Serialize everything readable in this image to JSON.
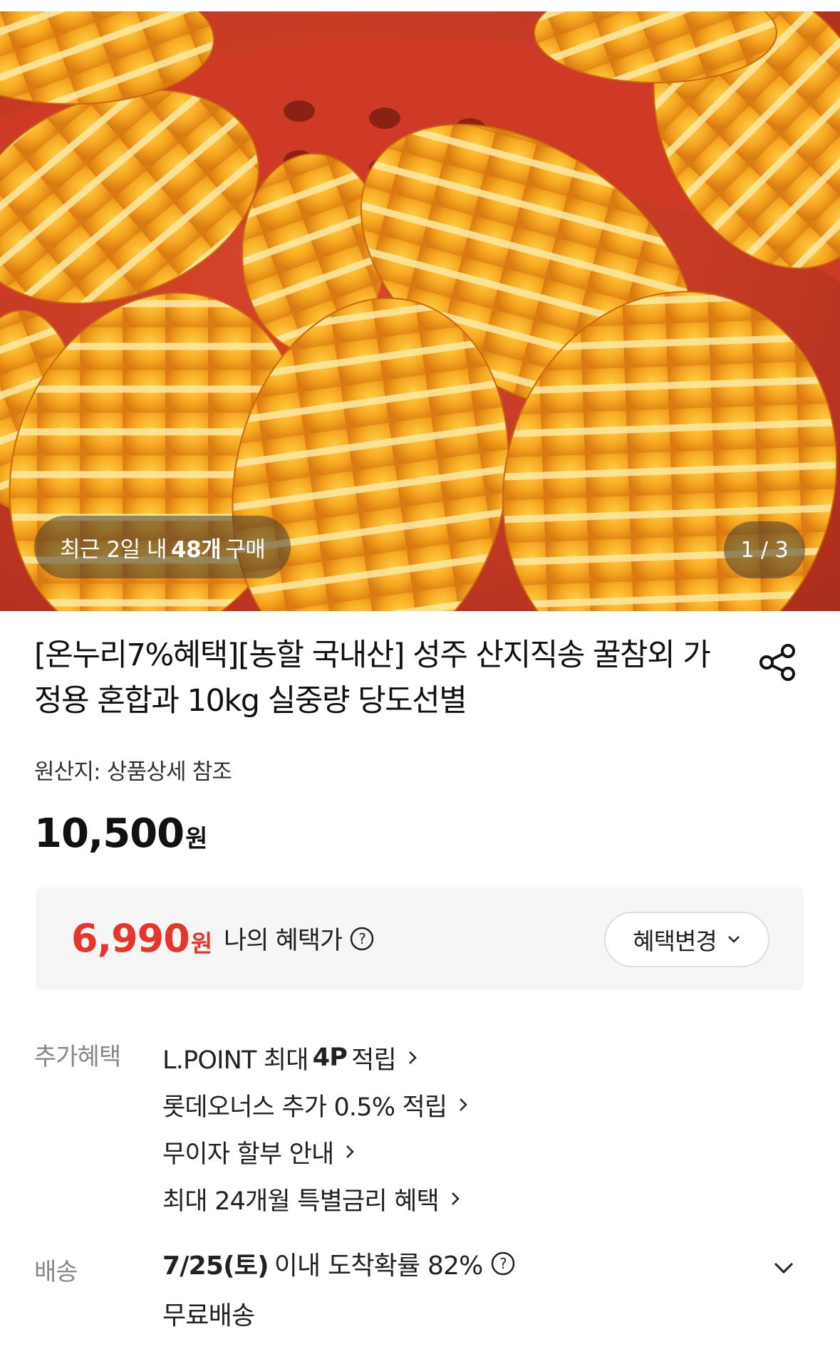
{
  "gallery": {
    "recent_purchase_prefix": "최근 2일 내",
    "recent_purchase_count": "48개",
    "recent_purchase_suffix": "구매",
    "counter": "1 / 3",
    "image_icon": "melon-product-photo"
  },
  "product": {
    "title": "[온누리7%혜택][농할 국내산] 성주 산지직송 꿀참외 가정용 혼합과 10kg 실중량 당도선별",
    "origin": "원산지: 상품상세 참조",
    "price_value": "10,500",
    "price_unit": "원",
    "share_icon": "share-icon"
  },
  "benefit_price": {
    "value": "6,990",
    "unit": "원",
    "label": "나의 혜택가",
    "help_icon": "question-circle-icon",
    "change_button": "혜택변경",
    "accent_color": "#e8352b"
  },
  "extra_benefits": {
    "label": "추가혜택",
    "items": [
      {
        "prefix": "L.POINT 최대",
        "bold": "4P",
        "suffix": "적립"
      },
      {
        "prefix": "롯데오너스 추가 0.5% 적립",
        "bold": "",
        "suffix": ""
      },
      {
        "prefix": "무이자 할부 안내",
        "bold": "",
        "suffix": ""
      },
      {
        "prefix": "최대 24개월 특별금리 혜택",
        "bold": "",
        "suffix": ""
      }
    ]
  },
  "delivery": {
    "label": "배송",
    "date": "7/25(토)",
    "text": "이내 도착확률 82%",
    "help_icon": "question-circle-icon",
    "shipping": "무료배송"
  }
}
